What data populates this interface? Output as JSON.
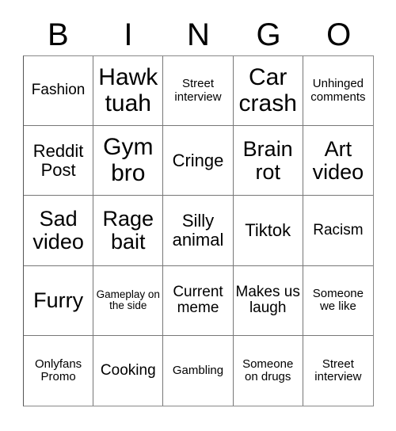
{
  "card": {
    "title": "BINGO",
    "headers": [
      "B",
      "I",
      "N",
      "G",
      "O"
    ],
    "grid_size": "5x5",
    "rows": [
      [
        {
          "text": "Fashion",
          "size": "fs-sm"
        },
        {
          "text": "Hawk tuah",
          "size": "fs-xl"
        },
        {
          "text": "Street interview",
          "size": "fs-xs"
        },
        {
          "text": "Car crash",
          "size": "fs-xl"
        },
        {
          "text": "Unhinged comments",
          "size": "fs-xs"
        }
      ],
      [
        {
          "text": "Reddit Post",
          "size": "fs-md"
        },
        {
          "text": "Gym bro",
          "size": "fs-xl"
        },
        {
          "text": "Cringe",
          "size": "fs-md"
        },
        {
          "text": "Brain rot",
          "size": "fs-lg"
        },
        {
          "text": "Art video",
          "size": "fs-lg"
        }
      ],
      [
        {
          "text": "Sad video",
          "size": "fs-lg"
        },
        {
          "text": "Rage bait",
          "size": "fs-lg"
        },
        {
          "text": "Silly animal",
          "size": "fs-md"
        },
        {
          "text": "Tiktok",
          "size": "fs-md"
        },
        {
          "text": "Racism",
          "size": "fs-sm"
        }
      ],
      [
        {
          "text": "Furry",
          "size": "fs-lg"
        },
        {
          "text": "Gameplay on the side",
          "size": "fs-xxs"
        },
        {
          "text": "Current meme",
          "size": "fs-sm"
        },
        {
          "text": "Makes us laugh",
          "size": "fs-sm"
        },
        {
          "text": "Someone we like",
          "size": "fs-xs"
        }
      ],
      [
        {
          "text": "Onlyfans Promo",
          "size": "fs-xs"
        },
        {
          "text": "Cooking",
          "size": "fs-sm"
        },
        {
          "text": "Gambling",
          "size": "fs-xs"
        },
        {
          "text": "Someone on drugs",
          "size": "fs-xs"
        },
        {
          "text": "Street interview",
          "size": "fs-xs"
        }
      ]
    ],
    "colors": {
      "background": "#ffffff",
      "text": "#000000",
      "grid_line": "#777777",
      "border": "#888888"
    }
  }
}
